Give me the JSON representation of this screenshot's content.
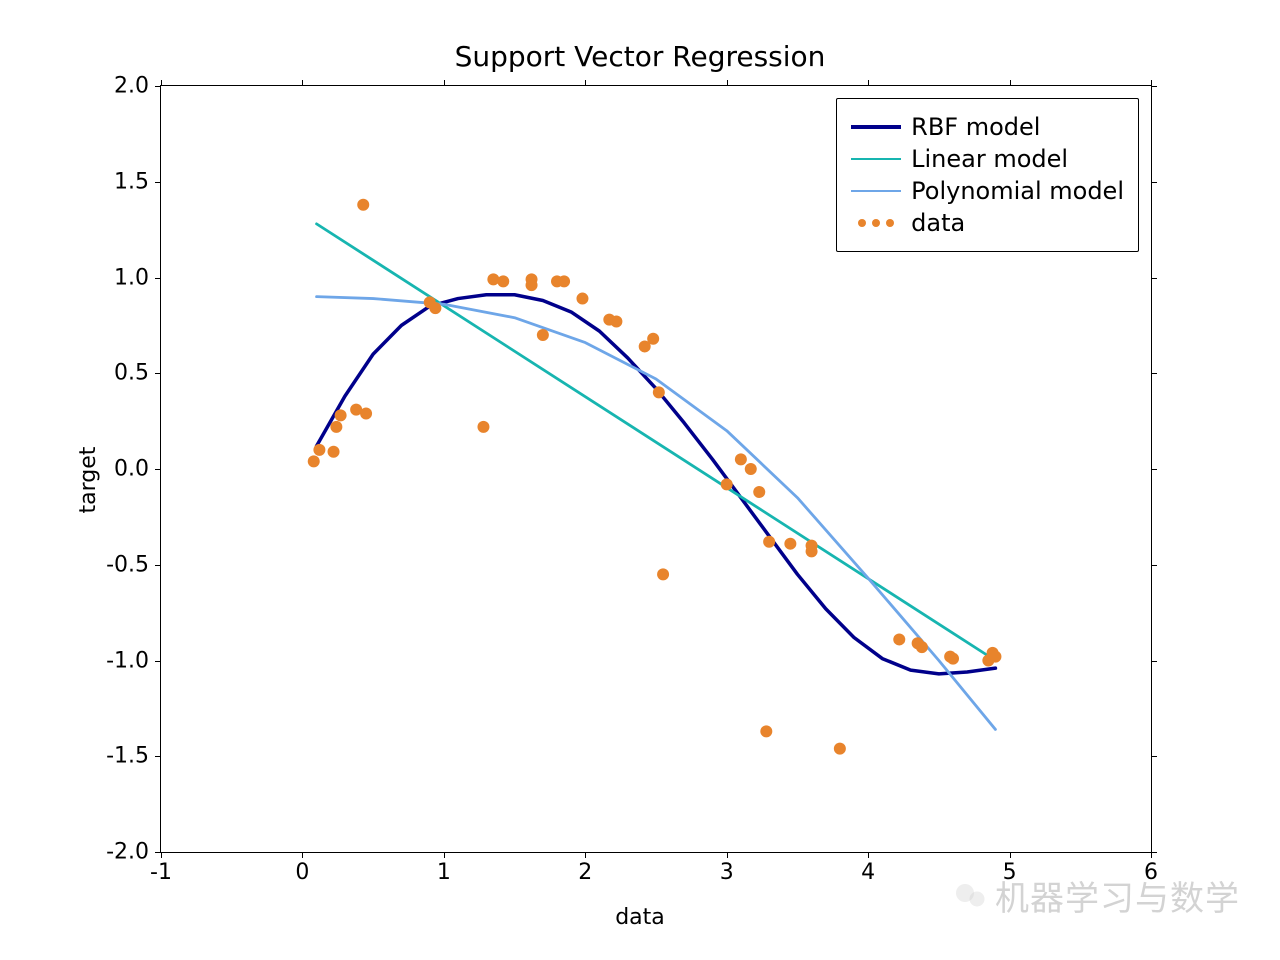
{
  "chart_data": {
    "type": "scatter",
    "title": "Support Vector Regression",
    "xlabel": "data",
    "ylabel": "target",
    "xlim": [
      -1,
      6
    ],
    "ylim": [
      -2.0,
      2.0
    ],
    "xticks": [
      -1,
      0,
      1,
      2,
      3,
      4,
      5,
      6
    ],
    "yticks": [
      -2.0,
      -1.5,
      -1.0,
      -0.5,
      0.0,
      0.5,
      1.0,
      1.5,
      2.0
    ],
    "legend_position": "upper right",
    "series": [
      {
        "name": "RBF model",
        "type": "line",
        "color": "#00008B",
        "width": 3.5,
        "x": [
          0.1,
          0.3,
          0.5,
          0.7,
          0.9,
          1.1,
          1.3,
          1.5,
          1.7,
          1.9,
          2.1,
          2.3,
          2.5,
          2.7,
          2.9,
          3.1,
          3.3,
          3.5,
          3.7,
          3.9,
          4.1,
          4.3,
          4.5,
          4.7,
          4.9
        ],
        "y": [
          0.12,
          0.38,
          0.6,
          0.75,
          0.85,
          0.89,
          0.91,
          0.91,
          0.88,
          0.82,
          0.72,
          0.58,
          0.42,
          0.24,
          0.05,
          -0.15,
          -0.35,
          -0.55,
          -0.73,
          -0.88,
          -0.99,
          -1.05,
          -1.07,
          -1.06,
          -1.04
        ]
      },
      {
        "name": "Linear model",
        "type": "line",
        "color": "#17b5b0",
        "width": 2.8,
        "x": [
          0.1,
          4.9
        ],
        "y": [
          1.28,
          -1.0
        ]
      },
      {
        "name": "Polynomial model",
        "type": "line",
        "color": "#6ea6e8",
        "width": 2.8,
        "x": [
          0.1,
          0.5,
          1.0,
          1.5,
          2.0,
          2.5,
          3.0,
          3.5,
          4.0,
          4.5,
          4.9
        ],
        "y": [
          0.9,
          0.89,
          0.86,
          0.79,
          0.66,
          0.47,
          0.2,
          -0.15,
          -0.57,
          -1.0,
          -1.36
        ]
      },
      {
        "name": "data",
        "type": "scatter",
        "color": "#e8842c",
        "marker_size": 6,
        "x": [
          0.08,
          0.12,
          0.22,
          0.24,
          0.27,
          0.38,
          0.43,
          0.45,
          0.9,
          0.94,
          1.28,
          1.35,
          1.42,
          1.62,
          1.62,
          1.7,
          1.8,
          1.85,
          1.98,
          2.17,
          2.22,
          2.42,
          2.48,
          2.52,
          2.55,
          3.0,
          3.1,
          3.17,
          3.23,
          3.28,
          3.3,
          3.45,
          3.6,
          3.6,
          3.8,
          4.22,
          4.35,
          4.38,
          4.58,
          4.6,
          4.85,
          4.88,
          4.9
        ],
        "y": [
          0.04,
          0.1,
          0.09,
          0.22,
          0.28,
          0.31,
          1.38,
          0.29,
          0.87,
          0.84,
          0.22,
          0.99,
          0.98,
          0.96,
          0.99,
          0.7,
          0.98,
          0.98,
          0.89,
          0.78,
          0.77,
          0.64,
          0.68,
          0.4,
          -0.55,
          -0.08,
          0.05,
          0.0,
          -0.12,
          -1.37,
          -0.38,
          -0.39,
          -0.43,
          -0.4,
          -1.46,
          -0.89,
          -0.91,
          -0.93,
          -0.98,
          -0.99,
          -1.0,
          -0.96,
          -0.98
        ]
      }
    ]
  },
  "watermark": "机器学习与数学"
}
